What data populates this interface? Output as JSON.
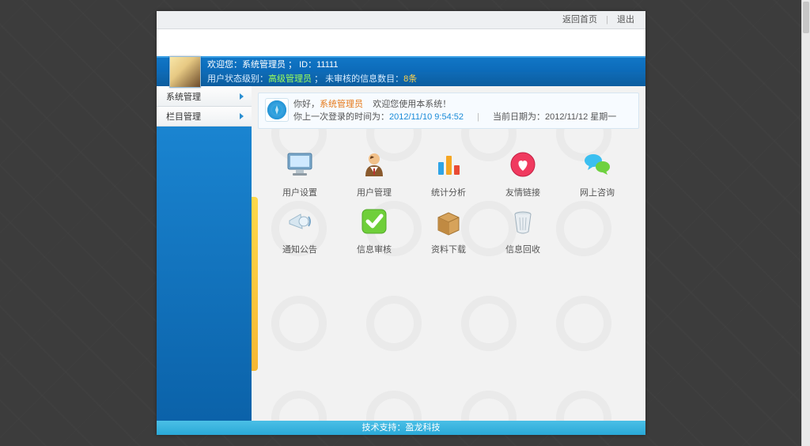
{
  "topbar": {
    "home": "返回首页",
    "logout": "退出"
  },
  "welcome": {
    "prefix": "欢迎您：",
    "role": "系统管理员",
    "id_label": "ID：",
    "id": "11111"
  },
  "status": {
    "prefix": "用户状态级别：",
    "level": "高级管理员",
    "pending_label": "未审核的信息数目：",
    "pending_count": "8条"
  },
  "sidebar": {
    "items": [
      {
        "label": "系统管理"
      },
      {
        "label": "栏目管理"
      }
    ]
  },
  "info": {
    "hello": "你好，",
    "role": "系统管理员",
    "welcome_sys": "欢迎您使用本系统！",
    "last_label": "你上一次登录的时间为：",
    "last_time": "2012/11/10 9:54:52",
    "today_label": "当前日期为：",
    "today": "2012/11/12 星期一"
  },
  "tiles": [
    {
      "key": "user-settings",
      "label": "用户设置"
    },
    {
      "key": "user-manage",
      "label": "用户管理"
    },
    {
      "key": "stats",
      "label": "统计分析"
    },
    {
      "key": "friend-link",
      "label": "友情链接"
    },
    {
      "key": "online-consult",
      "label": "网上咨询"
    },
    {
      "key": "notice",
      "label": "通知公告"
    },
    {
      "key": "audit",
      "label": "信息审核"
    },
    {
      "key": "download",
      "label": "资料下载"
    },
    {
      "key": "recycle",
      "label": "信息回收"
    }
  ],
  "footer": {
    "tech_label": "技术支持：",
    "company": "盈龙科技"
  }
}
